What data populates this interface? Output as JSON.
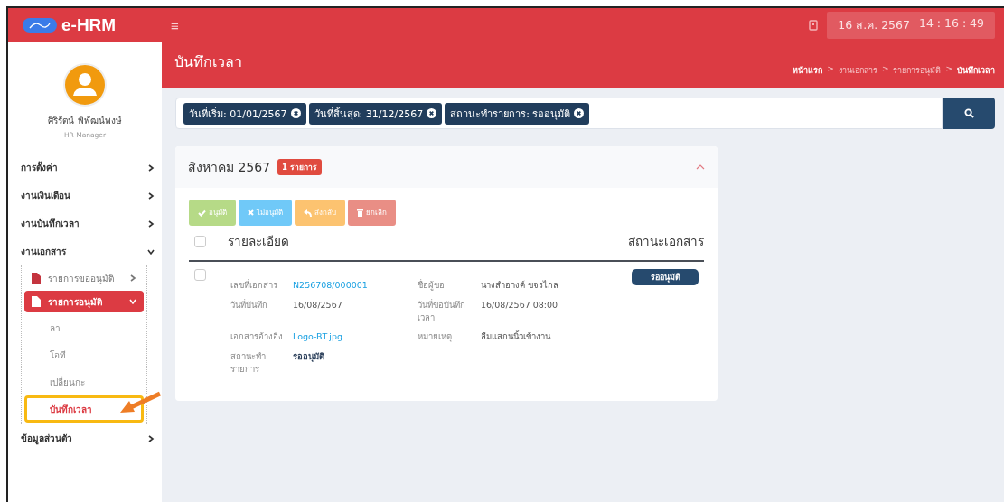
{
  "app": {
    "title": "e-HRM",
    "menu_icon": "≡"
  },
  "clock": {
    "date": "16 ส.ค. 2567",
    "time": "14 : 16 : 49"
  },
  "user": {
    "name": "ศิริรัตน์ พิพัฒน์พงษ์",
    "role": "HR Manager"
  },
  "sidebar": {
    "items": [
      {
        "label": "การตั้งค่า",
        "expanded": false
      },
      {
        "label": "งานเงินเดือน",
        "expanded": false
      },
      {
        "label": "งานบันทึกเวลา",
        "expanded": false
      },
      {
        "label": "งานเอกสาร",
        "expanded": true,
        "children": [
          {
            "label": "รายการขออนุมัติ",
            "expanded": false,
            "selected": false
          },
          {
            "label": "รายการอนุมัติ",
            "expanded": true,
            "selected": true,
            "children": [
              {
                "label": "ลา",
                "selected": false
              },
              {
                "label": "โอที",
                "selected": false
              },
              {
                "label": "เปลี่ยนกะ",
                "selected": false
              },
              {
                "label": "บันทึกเวลา",
                "selected": true
              }
            ]
          }
        ]
      },
      {
        "label": "ข้อมูลส่วนตัว",
        "expanded": false
      }
    ]
  },
  "page": {
    "title": "บันทึกเวลา",
    "separator": ">",
    "breadcrumb": [
      {
        "label": "หน้าแรก",
        "bold": true
      },
      {
        "label": "งานเอกสาร",
        "bold": false
      },
      {
        "label": "รายการอนุมัติ",
        "bold": false
      },
      {
        "label": "บันทึกเวลา",
        "bold": true
      }
    ]
  },
  "filters": [
    "วันที่เริ่ม: 01/01/2567",
    "วันที่สิ้นสุด: 31/12/2567",
    "สถานะทำรายการ: รออนุมัติ"
  ],
  "group": {
    "title": "สิงหาคม 2567",
    "count": "1 รายการ",
    "expanded": true,
    "actions": [
      {
        "kind": "approve",
        "label": "อนุมัติ",
        "disabled": true
      },
      {
        "kind": "reject",
        "label": "ไม่อนุมัติ",
        "disabled": true
      },
      {
        "kind": "return",
        "label": "ส่งกลับ",
        "disabled": true
      },
      {
        "kind": "cancel",
        "label": "ยกเลิก",
        "disabled": true
      }
    ],
    "columns": [
      "รายละเอียด",
      "สถานะเอกสาร"
    ],
    "select_all": {
      "checked": false
    },
    "rows": [
      {
        "checked": false,
        "status": "รออนุมัติ",
        "fields": [
          {
            "label": "เลขที่เอกสาร",
            "value": "N256708/000001",
            "kind": "link"
          },
          {
            "label": "ชื่อผู้ขอ",
            "value": "นางสำอางค์ ขจรไกล",
            "kind": "text"
          },
          {
            "label": "วันที่บันทึก",
            "value": "16/08/2567",
            "kind": "text"
          },
          {
            "label": "วันที่ขอบันทึกเวลา",
            "value": "16/08/2567 08:00",
            "kind": "text"
          },
          {
            "label": "เอกสารอ้างอิง",
            "value": "Logo-BT.jpg",
            "kind": "link"
          },
          {
            "label": "หมายเหตุ",
            "value": "ลืมแสกนนิ้วเข้างาน",
            "kind": "text"
          },
          {
            "label": "สถานะทำรายการ",
            "value": "รออนุมัติ",
            "kind": "strong"
          }
        ]
      }
    ]
  }
}
